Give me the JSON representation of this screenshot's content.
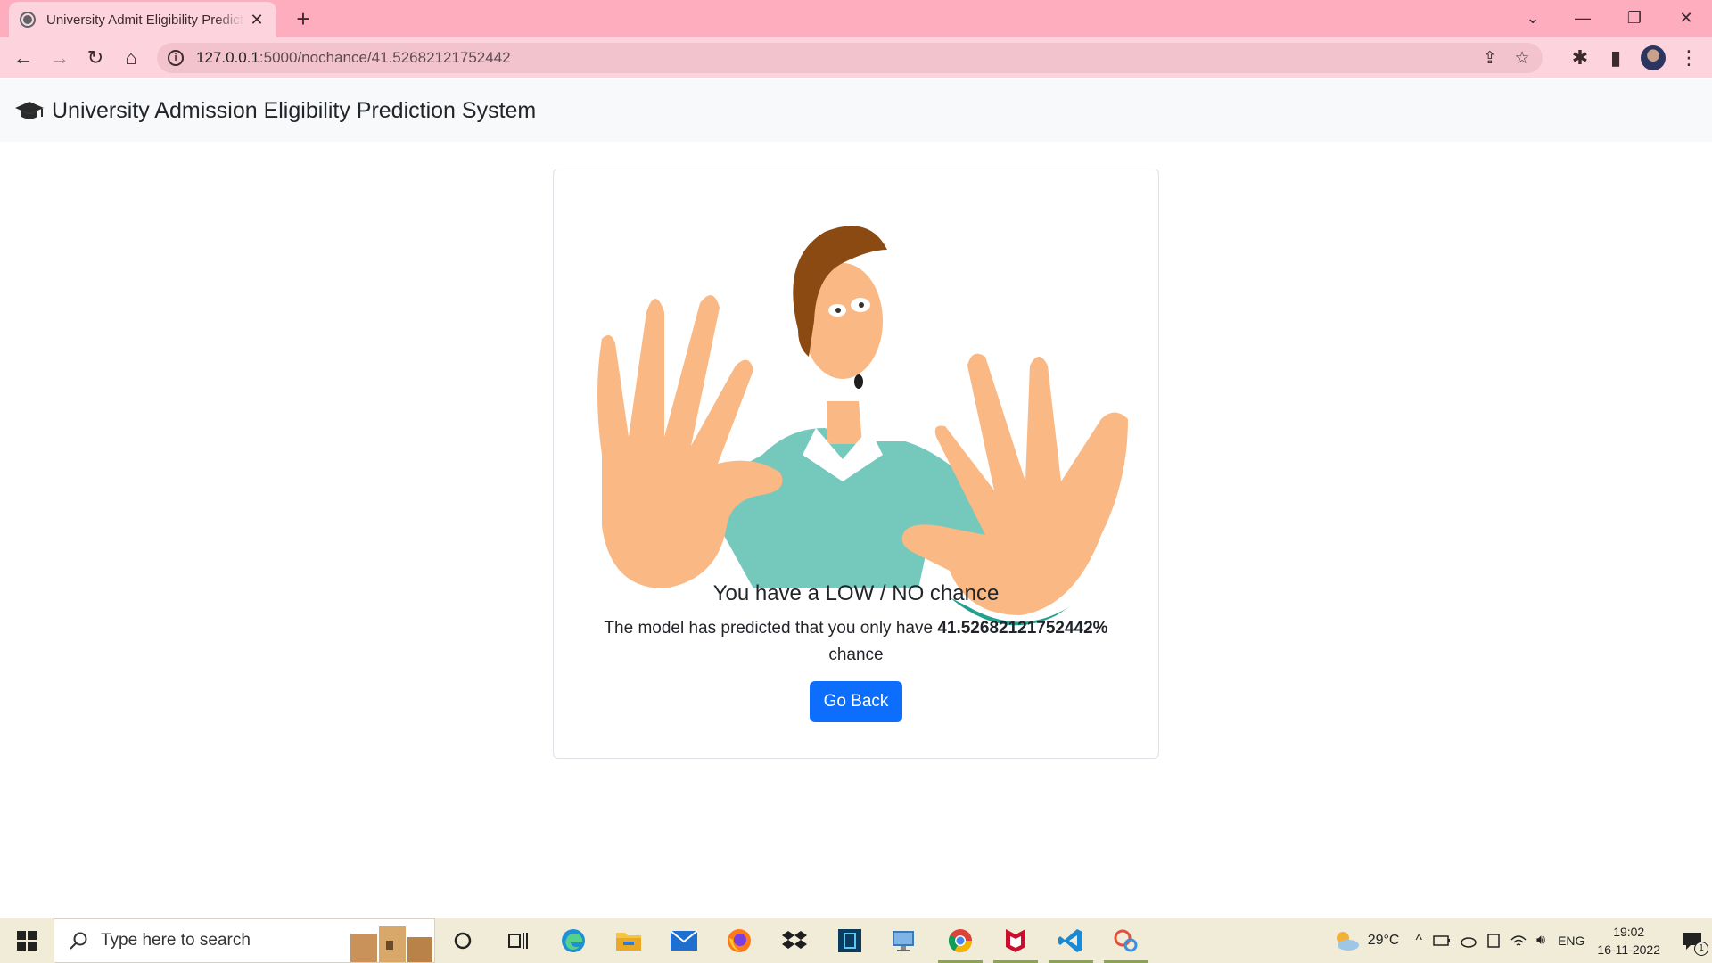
{
  "browser": {
    "tab_title": "University Admit Eligibility Prediction System",
    "url_host": "127.0.0.1",
    "url_path": ":5000/nochance/41.52682121752442"
  },
  "navbar": {
    "brand": "University Admission Eligibility Prediction System"
  },
  "result": {
    "heading": "You have a LOW / NO chance",
    "text_before": "The model has predicted that you only have ",
    "percentage": "41.52682121752442%",
    "text_after": "chance",
    "button_label": "Go Back"
  },
  "taskbar": {
    "search_placeholder": "Type here to search",
    "weather": "29°C",
    "language": "ENG",
    "time": "19:02",
    "date": "16-11-2022",
    "notification_count": "1"
  },
  "colors": {
    "browser_frame": "#fdadbe",
    "primary_button": "#0d6efd",
    "navbar_bg": "#f8f9fa"
  }
}
